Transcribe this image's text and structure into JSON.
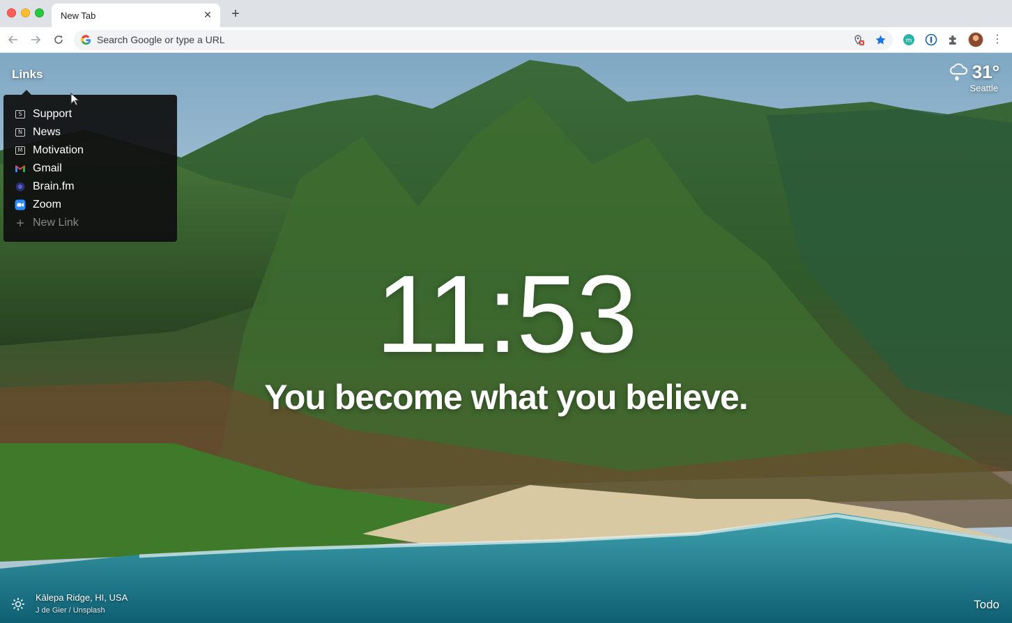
{
  "browser": {
    "tab_title": "New Tab",
    "tab_close_icon": "✕",
    "new_tab_icon": "+",
    "omnibox_placeholder": "Search Google or type a URL",
    "kebab_icon": "⋮"
  },
  "links": {
    "title": "Links",
    "items": [
      {
        "label": "Support",
        "icon": "letter-s-icon",
        "letter": "S"
      },
      {
        "label": "News",
        "icon": "letter-n-icon",
        "letter": "N"
      },
      {
        "label": "Motivation",
        "icon": "letter-m-icon",
        "letter": "M"
      },
      {
        "label": "Gmail",
        "icon": "gmail-icon"
      },
      {
        "label": "Brain.fm",
        "icon": "brainfm-icon"
      },
      {
        "label": "Zoom",
        "icon": "zoom-icon"
      }
    ],
    "new_link_label": "New Link"
  },
  "weather": {
    "temperature": "31°",
    "city": "Seattle",
    "icon": "cloud-snow-icon"
  },
  "clock": {
    "time": "11:53"
  },
  "mantra": {
    "text": "You become what you believe."
  },
  "photo": {
    "location": "Kālepa Ridge, HI, USA",
    "credit": "J de Gier / Unsplash"
  },
  "todo": {
    "label": "Todo"
  },
  "colors": {
    "panel_bg": "#0f0f0f",
    "chrome_bg": "#dee1e6",
    "accent_blue": "#1a73e8"
  }
}
